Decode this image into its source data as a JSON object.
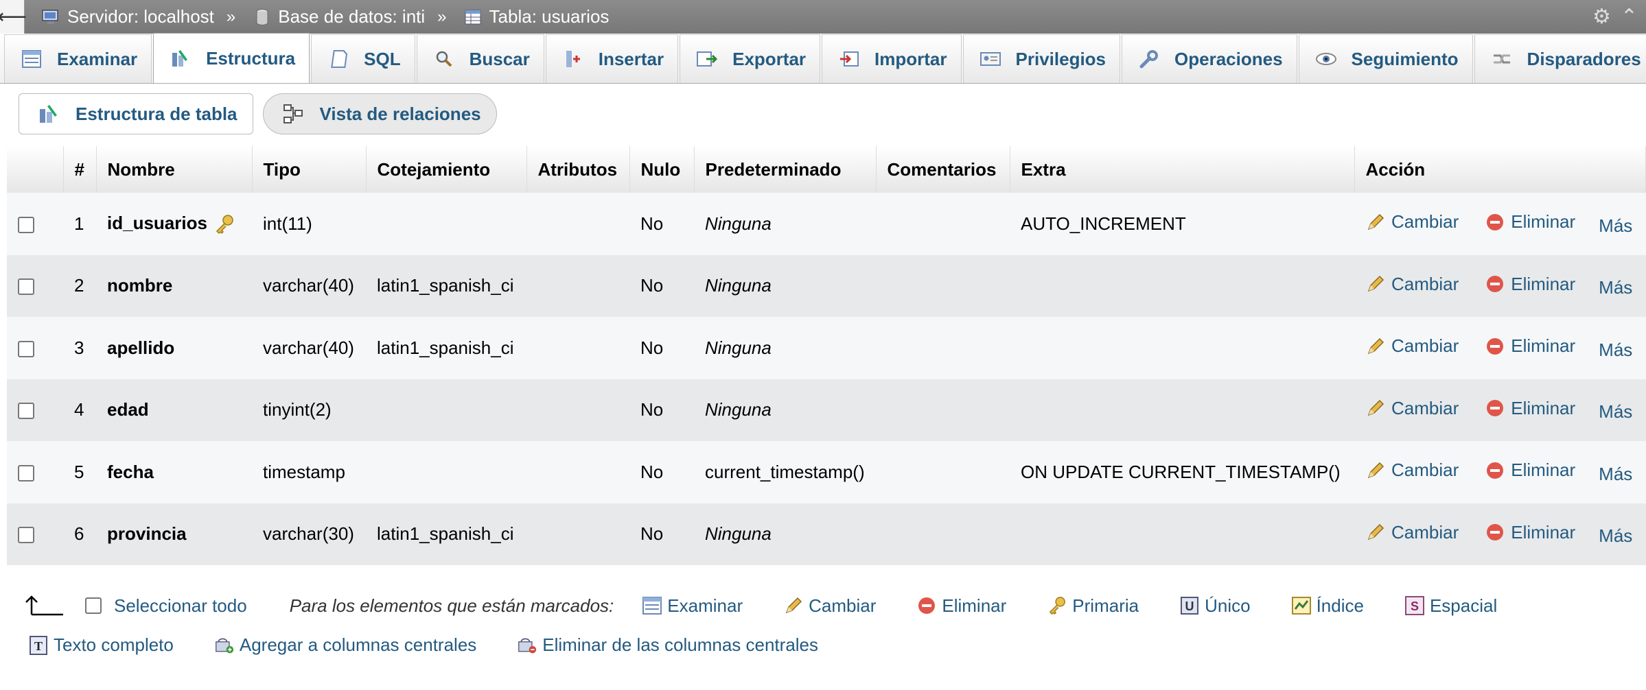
{
  "breadcrumb": {
    "server": "Servidor: localhost",
    "database": "Base de datos: inti",
    "table": "Tabla: usuarios",
    "separator": "»"
  },
  "tabs": [
    {
      "label": "Examinar",
      "icon": "browse-icon",
      "active": false
    },
    {
      "label": "Estructura",
      "icon": "structure-icon",
      "active": true
    },
    {
      "label": "SQL",
      "icon": "sql-icon",
      "active": false
    },
    {
      "label": "Buscar",
      "icon": "search-icon",
      "active": false
    },
    {
      "label": "Insertar",
      "icon": "insert-icon",
      "active": false
    },
    {
      "label": "Exportar",
      "icon": "export-icon",
      "active": false
    },
    {
      "label": "Importar",
      "icon": "import-icon",
      "active": false
    },
    {
      "label": "Privilegios",
      "icon": "privileges-icon",
      "active": false
    },
    {
      "label": "Operaciones",
      "icon": "wrench-icon",
      "active": false
    },
    {
      "label": "Seguimiento",
      "icon": "eye-icon",
      "active": false
    },
    {
      "label": "Disparadores",
      "icon": "triggers-icon",
      "active": false
    }
  ],
  "subnav": {
    "structure": "Estructura de tabla",
    "relations": "Vista de relaciones"
  },
  "table": {
    "headers": {
      "num": "#",
      "name": "Nombre",
      "type": "Tipo",
      "collation": "Cotejamiento",
      "attributes": "Atributos",
      "null": "Nulo",
      "default": "Predeterminado",
      "comments": "Comentarios",
      "extra": "Extra",
      "action": "Acción"
    },
    "rows": [
      {
        "num": "1",
        "name": "id_usuarios",
        "primary_key": true,
        "type": "int(11)",
        "collation": "",
        "attributes": "",
        "null": "No",
        "default": "Ninguna",
        "default_italic": true,
        "comments": "",
        "extra": "AUTO_INCREMENT"
      },
      {
        "num": "2",
        "name": "nombre",
        "primary_key": false,
        "type": "varchar(40)",
        "collation": "latin1_spanish_ci",
        "attributes": "",
        "null": "No",
        "default": "Ninguna",
        "default_italic": true,
        "comments": "",
        "extra": ""
      },
      {
        "num": "3",
        "name": "apellido",
        "primary_key": false,
        "type": "varchar(40)",
        "collation": "latin1_spanish_ci",
        "attributes": "",
        "null": "No",
        "default": "Ninguna",
        "default_italic": true,
        "comments": "",
        "extra": ""
      },
      {
        "num": "4",
        "name": "edad",
        "primary_key": false,
        "type": "tinyint(2)",
        "collation": "",
        "attributes": "",
        "null": "No",
        "default": "Ninguna",
        "default_italic": true,
        "comments": "",
        "extra": ""
      },
      {
        "num": "5",
        "name": "fecha",
        "primary_key": false,
        "type": "timestamp",
        "collation": "",
        "attributes": "",
        "null": "No",
        "default": "current_timestamp()",
        "default_italic": false,
        "comments": "",
        "extra": "ON UPDATE CURRENT_TIMESTAMP()"
      },
      {
        "num": "6",
        "name": "provincia",
        "primary_key": false,
        "type": "varchar(30)",
        "collation": "latin1_spanish_ci",
        "attributes": "",
        "null": "No",
        "default": "Ninguna",
        "default_italic": true,
        "comments": "",
        "extra": ""
      }
    ],
    "actions": {
      "change": "Cambiar",
      "drop": "Eliminar",
      "more": "Más"
    }
  },
  "bulk": {
    "select_all": "Seleccionar todo",
    "marked": "Para los elementos que están marcados:",
    "row1": [
      {
        "label": "Examinar",
        "icon": "browse-icon"
      },
      {
        "label": "Cambiar",
        "icon": "pencil-icon"
      },
      {
        "label": "Eliminar",
        "icon": "delete-icon"
      },
      {
        "label": "Primaria",
        "icon": "key-icon"
      },
      {
        "label": "Único",
        "icon": "unique-icon"
      },
      {
        "label": "Índice",
        "icon": "index-icon"
      },
      {
        "label": "Espacial",
        "icon": "spatial-icon"
      }
    ],
    "row2": [
      {
        "label": "Texto completo",
        "icon": "fulltext-icon"
      },
      {
        "label": "Agregar a columnas centrales",
        "icon": "central-add-icon"
      },
      {
        "label": "Eliminar de las columnas centrales",
        "icon": "central-remove-icon"
      }
    ]
  },
  "colors": {
    "link": "#235a81",
    "topbar": "#808080"
  }
}
